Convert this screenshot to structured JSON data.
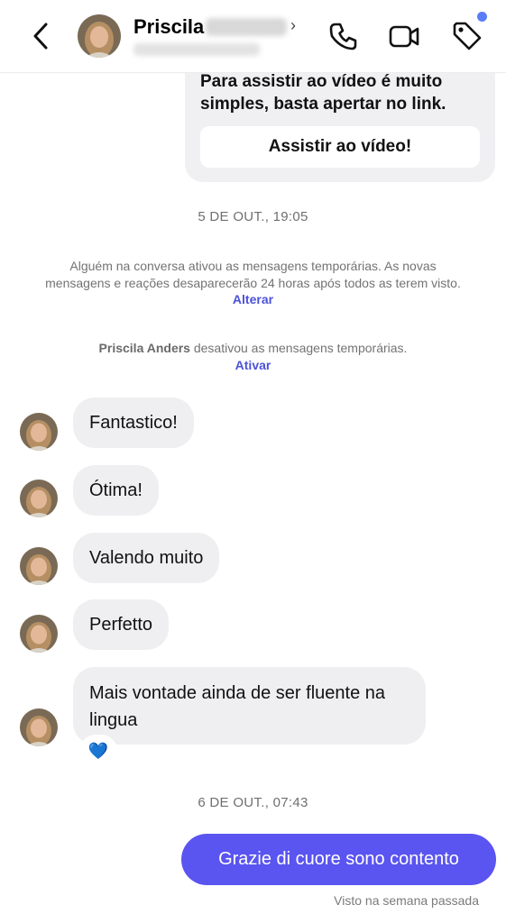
{
  "header": {
    "contact_name": "Priscila",
    "back_icon": "chevron-left-icon",
    "phone_icon": "phone-icon",
    "video_icon": "video-camera-icon",
    "tag_icon": "tag-icon",
    "accent_color": "#5b7cf7"
  },
  "shared_message": {
    "text": "Para assistir ao vídeo é muito simples, basta apertar no link.",
    "button_label": "Assistir ao vídeo!"
  },
  "timestamps": {
    "first": "5 DE OUT., 19:05",
    "second": "6 DE OUT., 07:43"
  },
  "system_messages": {
    "temp_on": "Alguém na conversa ativou as mensagens temporárias. As novas mensagens e reações desaparecerão 24 horas após todos as terem visto.",
    "temp_on_link": "Alterar",
    "temp_off_actor": "Priscila Anders",
    "temp_off_text": "desativou as mensagens temporárias.",
    "temp_off_link": "Ativar"
  },
  "incoming_messages": [
    {
      "text": "Fantastico!"
    },
    {
      "text": "Ótima!"
    },
    {
      "text": "Valendo muito"
    },
    {
      "text": "Perfetto"
    },
    {
      "text": "Mais vontade ainda de ser fluente na lingua",
      "reaction": "💙"
    }
  ],
  "outgoing_message": {
    "text": "Grazie di cuore sono contento",
    "color": "#5a54f0",
    "status": "Visto na semana passada"
  }
}
